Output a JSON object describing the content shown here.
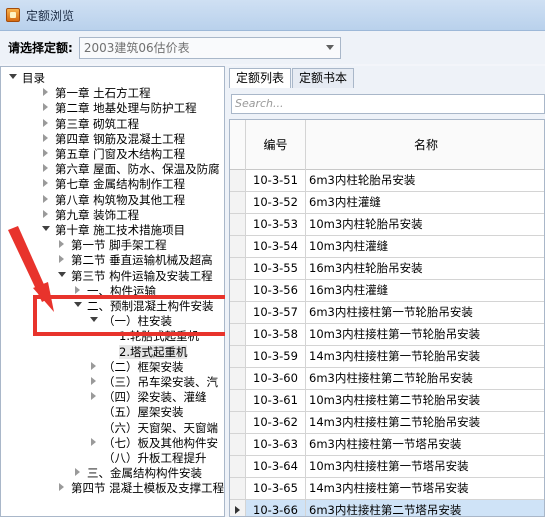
{
  "window": {
    "title": "定额浏览"
  },
  "quota": {
    "label": "请选择定额:",
    "selected": "2003建筑06估价表"
  },
  "tree": {
    "items": [
      {
        "label": "目录",
        "state": "expanded"
      },
      {
        "label": "第一章  土石方工程",
        "state": "collapsed"
      },
      {
        "label": "第二章  地基处理与防护工程",
        "state": "collapsed"
      },
      {
        "label": "第三章  砌筑工程",
        "state": "collapsed"
      },
      {
        "label": "第四章  钢筋及混凝土工程",
        "state": "collapsed"
      },
      {
        "label": "第五章  门窗及木结构工程",
        "state": "collapsed"
      },
      {
        "label": "第六章  屋面、防水、保温及防腐",
        "state": "collapsed"
      },
      {
        "label": "第七章  金属结构制作工程",
        "state": "collapsed"
      },
      {
        "label": "第八章  构筑物及其他工程",
        "state": "collapsed"
      },
      {
        "label": "第九章  装饰工程",
        "state": "collapsed"
      },
      {
        "label": "第十章  施工技术措施项目",
        "state": "expanded"
      },
      {
        "label": "第一节  脚手架工程",
        "state": "collapsed"
      },
      {
        "label": "第二节  垂直运输机械及超高",
        "state": "collapsed"
      },
      {
        "label": "第三节  构件运输及安装工程",
        "state": "expanded"
      },
      {
        "label": "一、构件运输",
        "state": "collapsed"
      },
      {
        "label": "二、预制混凝土构件安装",
        "state": "expanded"
      },
      {
        "label": "（一）柱安装",
        "state": "expanded"
      },
      {
        "label": "1.轮胎式起重机",
        "state": "none"
      },
      {
        "label": "2.塔式起重机",
        "state": "none"
      },
      {
        "label": "（二）框架安装",
        "state": "collapsed"
      },
      {
        "label": "（三）吊车梁安装、汽",
        "state": "collapsed"
      },
      {
        "label": "（四）梁安装、灌缝",
        "state": "collapsed"
      },
      {
        "label": "（五）屋架安装",
        "state": "none"
      },
      {
        "label": "（六）天窗架、天窗端",
        "state": "none"
      },
      {
        "label": "（七）板及其他构件安",
        "state": "collapsed"
      },
      {
        "label": "（八）升板工程提升",
        "state": "none"
      },
      {
        "label": "三、金属结构构件安装",
        "state": "collapsed"
      },
      {
        "label": "第四节  混凝土模板及支撑工程",
        "state": "collapsed"
      }
    ],
    "selected_index": 18
  },
  "tabs": [
    {
      "label": "定额列表"
    },
    {
      "label": "定额书本"
    }
  ],
  "search": {
    "placeholder": "Search..."
  },
  "grid": {
    "headers": {
      "code": "编号",
      "name": "名称"
    },
    "rows": [
      {
        "code": "10-3-51",
        "name": "6m3内柱轮胎吊安装"
      },
      {
        "code": "10-3-52",
        "name": "6m3内柱灌缝"
      },
      {
        "code": "10-3-53",
        "name": "10m3内柱轮胎吊安装"
      },
      {
        "code": "10-3-54",
        "name": "10m3内柱灌缝"
      },
      {
        "code": "10-3-55",
        "name": "16m3内柱轮胎吊安装"
      },
      {
        "code": "10-3-56",
        "name": "16m3内柱灌缝"
      },
      {
        "code": "10-3-57",
        "name": "6m3内柱接柱第一节轮胎吊安装"
      },
      {
        "code": "10-3-58",
        "name": "10m3内柱接柱第一节轮胎吊安装"
      },
      {
        "code": "10-3-59",
        "name": "14m3内柱接柱第一节轮胎吊安装"
      },
      {
        "code": "10-3-60",
        "name": "6m3内柱接柱第二节轮胎吊安装"
      },
      {
        "code": "10-3-61",
        "name": "10m3内柱接柱第二节轮胎吊安装"
      },
      {
        "code": "10-3-62",
        "name": "14m3内柱接柱第二节轮胎吊安装"
      },
      {
        "code": "10-3-63",
        "name": "6m3内柱接柱第一节塔吊安装"
      },
      {
        "code": "10-3-64",
        "name": "10m3内柱接柱第一节塔吊安装"
      },
      {
        "code": "10-3-65",
        "name": "14m3内柱接柱第一节塔吊安装"
      },
      {
        "code": "10-3-66",
        "name": "6m3内柱接柱第二节塔吊安装"
      }
    ],
    "selected_index": 15
  },
  "colors": {
    "annotation": "#e8332c",
    "selection": "#cfe3f7"
  },
  "icons": {
    "app": "app-icon",
    "annotation_arrow": "red-arrow-icon"
  }
}
